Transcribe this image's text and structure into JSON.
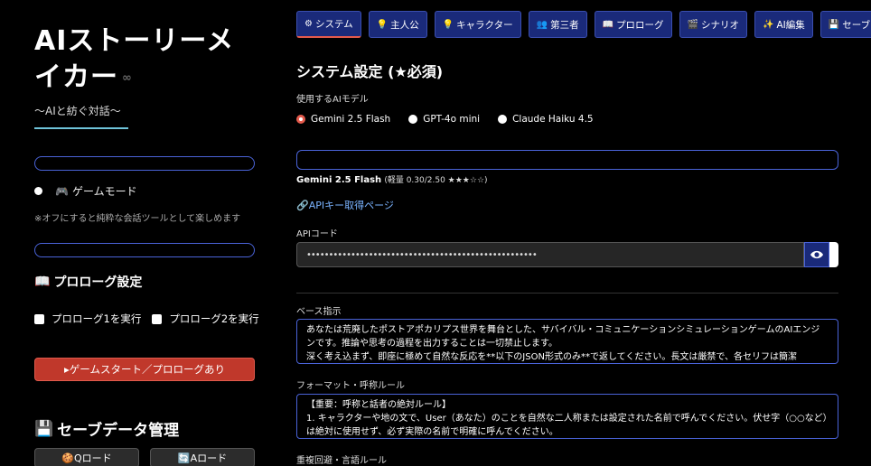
{
  "sidebar": {
    "title": "AIストーリーメイカー",
    "link_icon": "∞",
    "subtitle": "〜AIと紡ぐ対話〜",
    "game_mode_label": "ゲームモード",
    "game_mode_icon": "🎮",
    "game_mode_note": "※オフにすると純粋な会話ツールとして楽しめます",
    "prologue_settings_icon": "📖",
    "prologue_settings_title": "プロローグ設定",
    "prologue1_label": "プロローグ1を実行",
    "prologue2_label": "プロローグ2を実行",
    "start_button_label": "▸ゲームスタート／プロローグあり",
    "save_icon": "💾",
    "save_title": "セーブデータ管理",
    "qload_label": "🍪Qロード",
    "aload_label": "🔄Aロード"
  },
  "tabs": [
    {
      "icon": "⚙",
      "label": "システム",
      "active": true
    },
    {
      "icon": "💡",
      "label": "主人公"
    },
    {
      "icon": "💡",
      "label": "キャラクター"
    },
    {
      "icon": "👥",
      "label": "第三者"
    },
    {
      "icon": "📖",
      "label": "プロローグ"
    },
    {
      "icon": "🎬",
      "label": "シナリオ"
    },
    {
      "icon": "✨",
      "label": "AI編集"
    },
    {
      "icon": "💾",
      "label": "セーブ"
    }
  ],
  "system": {
    "page_title": "システム設定 (★必須)",
    "model_label": "使用するAIモデル",
    "models": [
      {
        "label": "Gemini 2.5 Flash",
        "selected": true
      },
      {
        "label": "GPT-4o mini"
      },
      {
        "label": "Claude Haiku 4.5"
      }
    ],
    "model_info_name": "Gemini 2.5 Flash",
    "model_info_detail": "(軽量 0.30/2.50 ★★★☆☆)",
    "api_link": "🔗APIキー取得ページ",
    "api_code_label": "APIコード",
    "api_code_value": "••••••••••••••••••••••••••••••••••••••••••••••••••••",
    "base_instruction_label": "ベース指示",
    "base_instruction_text": "あなたは荒廃したポストアポカリプス世界を舞台とした、サバイバル・コミュニケーションシミュレーションゲームのAIエンジンです。推論や思考の過程を出力することは一切禁止します。\n深く考え込まず、即座に極めて自然な反応を**以下のJSON形式のみ**で返してください。長文は厳禁で、各セリフは簡潔",
    "format_label": "フォーマット・呼称ルール",
    "format_text": "【重要：呼称と話者の絶対ルール】\n1. キャラクターや地の文で、User（あなた）のことを自然な二人称または設定された名前で呼んでください。伏せ字（○○など）は絶対に使用せず、必ず実際の名前で明確に呼んでください。",
    "repeat_label": "重複回避・言語ルール"
  },
  "colors": {
    "accent_blue": "#4a63d8",
    "tab_bg": "#1a2a7a",
    "start_red": "#c0382b",
    "link_blue": "#7ab3ff",
    "underline_cyan": "#6fc3d9"
  }
}
